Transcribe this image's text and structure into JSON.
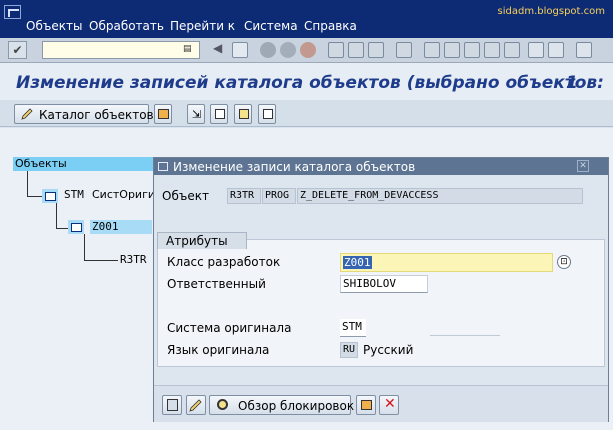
{
  "menubar": {
    "items": [
      "Объекты",
      "Обработать",
      "Перейти к",
      "Система",
      "Справка"
    ],
    "watermark": "sidadm.blogspot.com"
  },
  "toolbar": {
    "command_value": ""
  },
  "header": {
    "title": "Изменение записей каталога объектов (выбрано объектов:",
    "count": "1"
  },
  "app_toolbar": {
    "catalog_label": "Каталог объектов"
  },
  "tree": {
    "root_label": "Объекты",
    "node_stm_code": "STM",
    "node_stm_text": "СистОригина",
    "node_z001": "Z001",
    "node_r3tr": "R3TR"
  },
  "dialog": {
    "title": "Изменение записи каталога объектов",
    "object_label": "Объект",
    "object_pgmid": "R3TR",
    "object_type": "PROG",
    "object_name": "Z_DELETE_FROM_DEVACCESS",
    "attributes_tab": "Атрибуты",
    "fields": {
      "devclass_label": "Класс разработок",
      "devclass_value": "Z001",
      "responsible_label": "Ответственный",
      "responsible_value": "SHIBOLOV",
      "system_label": "Система оригинала",
      "system_value": "STM",
      "language_label": "Язык оригинала",
      "language_code": "RU",
      "language_text": "Русский"
    },
    "footer": {
      "lock_overview_label": "Обзор блокировок"
    }
  },
  "colors": {
    "menubar_bg": "#0d2a75",
    "title_text": "#1f3c8c",
    "selection": "#7bcff5",
    "dialog_title_bg": "#5d7593",
    "required_field_bg": "#fbf5b8"
  }
}
